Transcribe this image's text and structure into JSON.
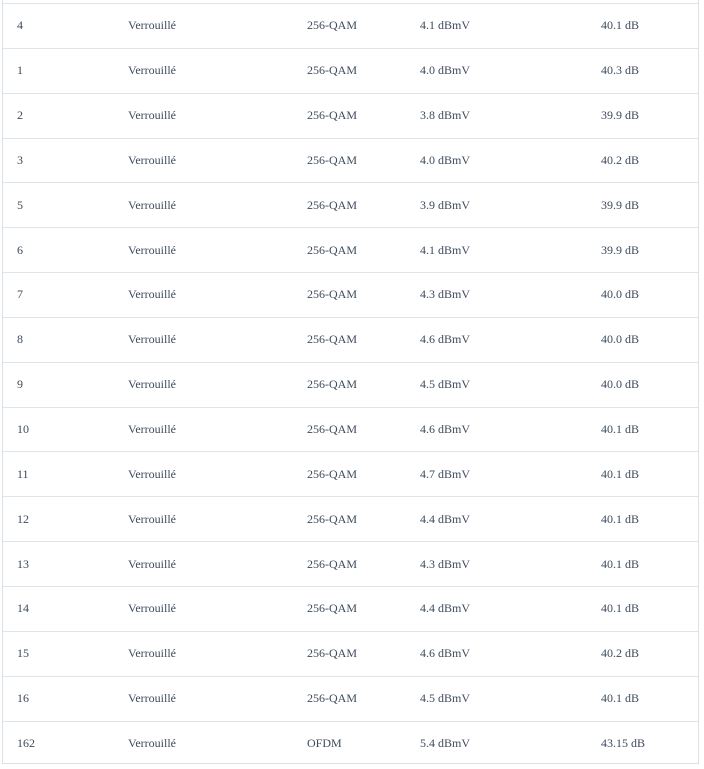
{
  "downstream_table": {
    "rows": [
      {
        "channel_id": "4",
        "status": "Verrouillé",
        "modulation": "256-QAM",
        "power": "4.1 dBmV",
        "snr": "40.1 dB"
      },
      {
        "channel_id": "1",
        "status": "Verrouillé",
        "modulation": "256-QAM",
        "power": "4.0 dBmV",
        "snr": "40.3 dB"
      },
      {
        "channel_id": "2",
        "status": "Verrouillé",
        "modulation": "256-QAM",
        "power": "3.8 dBmV",
        "snr": "39.9 dB"
      },
      {
        "channel_id": "3",
        "status": "Verrouillé",
        "modulation": "256-QAM",
        "power": "4.0 dBmV",
        "snr": "40.2 dB"
      },
      {
        "channel_id": "5",
        "status": "Verrouillé",
        "modulation": "256-QAM",
        "power": "3.9 dBmV",
        "snr": "39.9 dB"
      },
      {
        "channel_id": "6",
        "status": "Verrouillé",
        "modulation": "256-QAM",
        "power": "4.1 dBmV",
        "snr": "39.9 dB"
      },
      {
        "channel_id": "7",
        "status": "Verrouillé",
        "modulation": "256-QAM",
        "power": "4.3 dBmV",
        "snr": "40.0 dB"
      },
      {
        "channel_id": "8",
        "status": "Verrouillé",
        "modulation": "256-QAM",
        "power": "4.6 dBmV",
        "snr": "40.0 dB"
      },
      {
        "channel_id": "9",
        "status": "Verrouillé",
        "modulation": "256-QAM",
        "power": "4.5 dBmV",
        "snr": "40.0 dB"
      },
      {
        "channel_id": "10",
        "status": "Verrouillé",
        "modulation": "256-QAM",
        "power": "4.6 dBmV",
        "snr": "40.1 dB"
      },
      {
        "channel_id": "11",
        "status": "Verrouillé",
        "modulation": "256-QAM",
        "power": "4.7 dBmV",
        "snr": "40.1 dB"
      },
      {
        "channel_id": "12",
        "status": "Verrouillé",
        "modulation": "256-QAM",
        "power": "4.4 dBmV",
        "snr": "40.1 dB"
      },
      {
        "channel_id": "13",
        "status": "Verrouillé",
        "modulation": "256-QAM",
        "power": "4.3 dBmV",
        "snr": "40.1 dB"
      },
      {
        "channel_id": "14",
        "status": "Verrouillé",
        "modulation": "256-QAM",
        "power": "4.4 dBmV",
        "snr": "40.1 dB"
      },
      {
        "channel_id": "15",
        "status": "Verrouillé",
        "modulation": "256-QAM",
        "power": "4.6 dBmV",
        "snr": "40.2 dB"
      },
      {
        "channel_id": "16",
        "status": "Verrouillé",
        "modulation": "256-QAM",
        "power": "4.5 dBmV",
        "snr": "40.1 dB"
      },
      {
        "channel_id": "162",
        "status": "Verrouillé",
        "modulation": "OFDM",
        "power": "5.4 dBmV",
        "snr": "43.15 dB"
      }
    ]
  },
  "colors": {
    "text": "#3d4b5c",
    "border": "#dde5ea"
  }
}
